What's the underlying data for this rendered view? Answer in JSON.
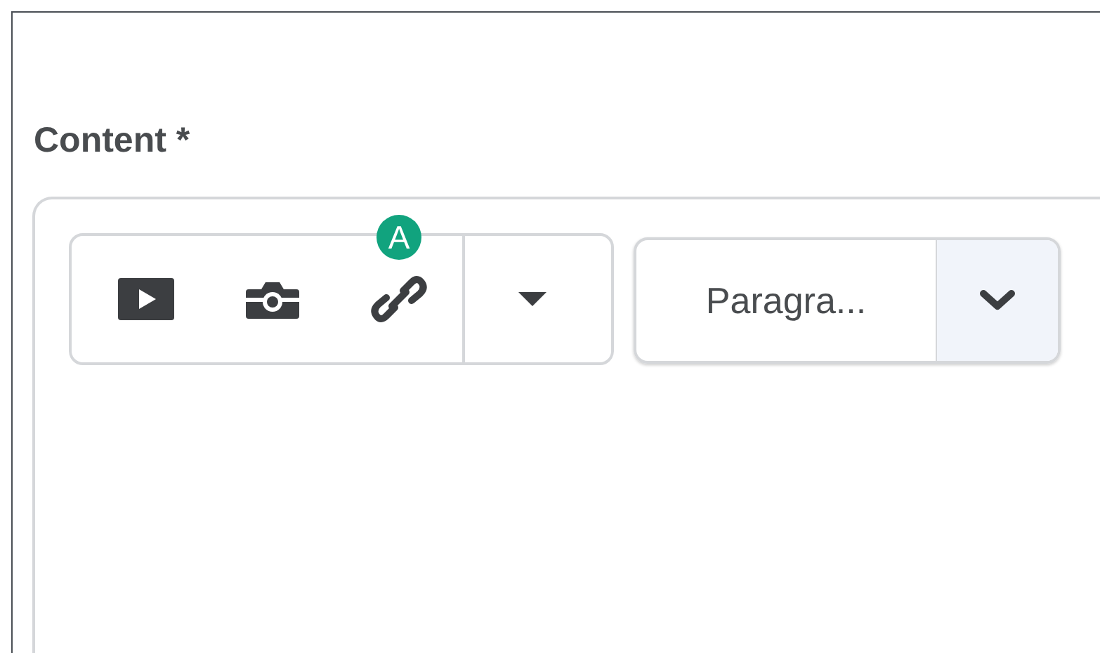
{
  "field_label": "Content *",
  "toolbar": {
    "buttons": [
      {
        "kind": "video"
      },
      {
        "kind": "camera"
      },
      {
        "kind": "link",
        "badge": "A"
      }
    ],
    "more": {
      "kind": "caret"
    }
  },
  "format_select": {
    "value": "Paragra..."
  }
}
